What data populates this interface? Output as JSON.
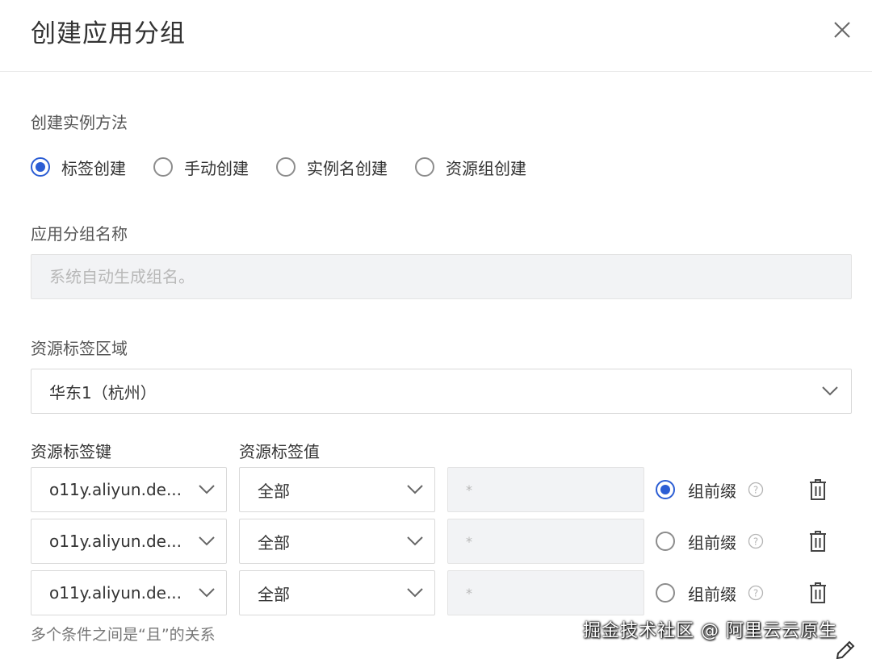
{
  "dialog": {
    "title": "创建应用分组"
  },
  "method": {
    "label": "创建实例方法",
    "options": [
      {
        "label": "标签创建",
        "checked": true
      },
      {
        "label": "手动创建",
        "checked": false
      },
      {
        "label": "实例名创建",
        "checked": false
      },
      {
        "label": "资源组创建",
        "checked": false
      }
    ]
  },
  "group_name": {
    "label": "应用分组名称",
    "placeholder": "系统自动生成组名。",
    "value": ""
  },
  "region": {
    "label": "资源标签区域",
    "value": "华东1（杭州）"
  },
  "tags": {
    "key_label": "资源标签键",
    "value_label": "资源标签值",
    "rows": [
      {
        "key": "o11y.aliyun.de...",
        "scope": "全部",
        "placeholder": "*",
        "prefix_label": "组前缀",
        "prefix_checked": true
      },
      {
        "key": "o11y.aliyun.de...",
        "scope": "全部",
        "placeholder": "*",
        "prefix_label": "组前缀",
        "prefix_checked": false
      },
      {
        "key": "o11y.aliyun.de...",
        "scope": "全部",
        "placeholder": "*",
        "prefix_label": "组前缀",
        "prefix_checked": false
      }
    ],
    "hint": "多个条件之间是“且”的关系"
  },
  "watermark": "掘金技术社区 @ 阿里云云原生",
  "colors": {
    "accent": "#2b5dd4",
    "disabled_bg": "#f2f3f5",
    "border": "#d9d9d9"
  },
  "icons": {
    "close": "close-icon",
    "chevron": "chevron-down-icon",
    "help": "question-circle-icon",
    "trash": "trash-icon",
    "edit": "edit-icon"
  }
}
